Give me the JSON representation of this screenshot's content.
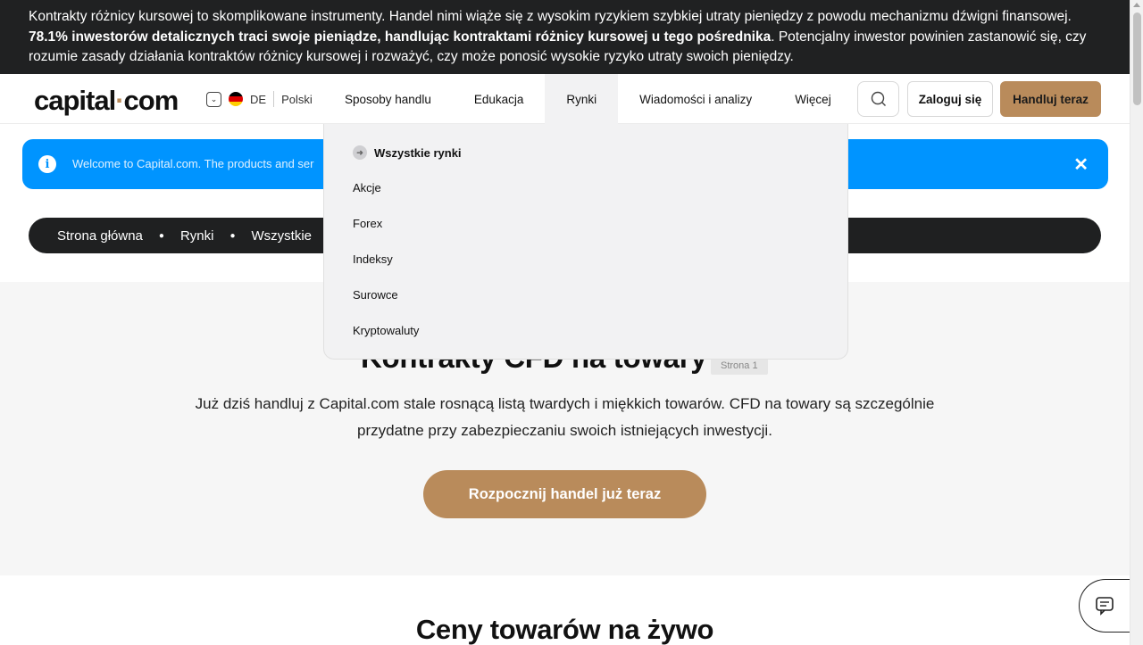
{
  "risk_banner": {
    "text_before": "Kontrakty różnicy kursowej to skomplikowane instrumenty. Handel nimi wiąże się z wysokim ryzykiem szybkiej utraty pieniędzy z powodu mechanizmu dźwigni finansowej. ",
    "bold": "78.1% inwestorów detalicznych traci swoje pieniądze, handlując kontraktami różnicy kursowej u tego pośrednika",
    "text_after": ". Potencjalny inwestor powinien zastanowić się, czy rozumie zasady działania kontraktów różnicy kursowej i rozważyć, czy może ponosić wysokie ryzyko utraty swoich pieniędzy."
  },
  "header": {
    "logo_left": "capital",
    "logo_dot": "·",
    "logo_right": "com",
    "country_code": "DE",
    "language": "Polski",
    "nav": [
      "Sposoby handlu",
      "Edukacja",
      "Rynki",
      "Wiadomości i analizy",
      "Więcej"
    ],
    "login_label": "Zaloguj się",
    "trade_label": "Handluj teraz"
  },
  "info_bar": {
    "text": "Welcome to Capital.com. The products and ser"
  },
  "breadcrumb": [
    "Strona główna",
    "Rynki",
    "Wszystkie"
  ],
  "hero": {
    "title": "Kontrakty CFD na towary",
    "page_tag": "Strona 1",
    "description": "Już dziś handluj z Capital.com stale rosnącą listą twardych i miękkich towarów. CFD na towary są szczególnie przydatne przy zabezpieczaniu swoich istniejących inwestycji.",
    "cta_label": "Rozpocznij handel już teraz"
  },
  "bottom_heading": "Ceny towarów na żywo",
  "dropdown": {
    "all_label": "Wszystkie rynki",
    "items": [
      "Akcje",
      "Forex",
      "Indeksy",
      "Surowce",
      "Kryptowaluty"
    ]
  },
  "colors": {
    "accent": "#b98b5b",
    "info": "#0094ff",
    "dark": "#1f2021"
  }
}
